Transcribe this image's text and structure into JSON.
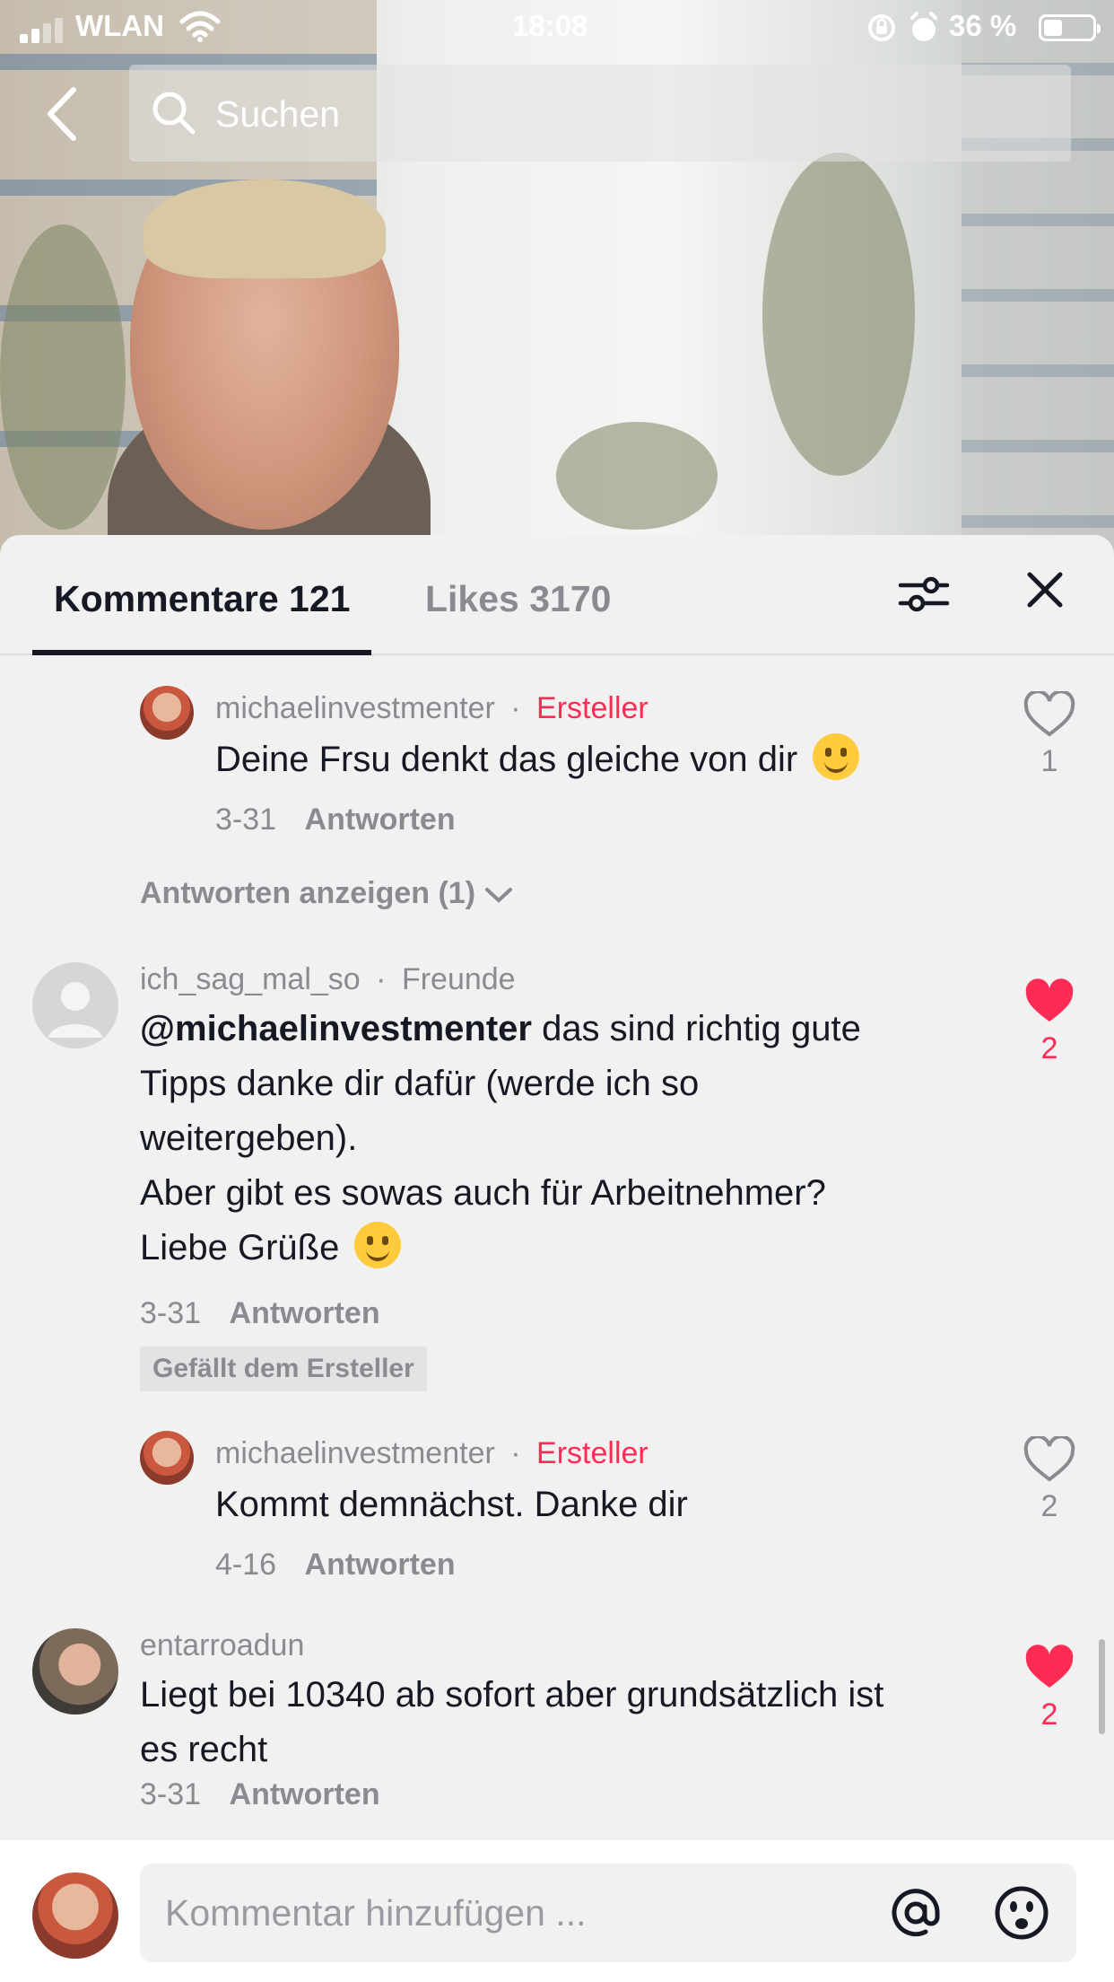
{
  "status": {
    "carrier": "WLAN",
    "time": "18:08",
    "battery": "36 %"
  },
  "search": {
    "placeholder": "Suchen"
  },
  "tabs": {
    "comments": "Kommentare 121",
    "likes": "Likes 3170"
  },
  "comments": [
    {
      "username": "michaelinvestmenter",
      "separator": "·",
      "tag": "Ersteller",
      "text": "Deine Frsu denkt das gleiche von dir",
      "emoji": "grinning-sweat-emoji",
      "date": "3-31",
      "reply": "Antworten",
      "likes": "1",
      "liked": false
    },
    {
      "show_replies": "Antworten anzeigen (1)"
    },
    {
      "username": "ich_sag_mal_so",
      "separator": "·",
      "tag": "Freunde",
      "mention": "@michaelinvestmenter",
      "text_lines": [
        " das sind richtig gute",
        "Tipps danke dir dafür (werde ich so",
        "weitergeben).",
        "Aber gibt es sowas auch für Arbeitnehmer?",
        "Liebe Grüße"
      ],
      "emoji": "winking-face-emoji",
      "date": "3-31",
      "reply": "Antworten",
      "badge": "Gefällt dem Ersteller",
      "likes": "2",
      "liked": true
    },
    {
      "username": "michaelinvestmenter",
      "separator": "·",
      "tag": "Ersteller",
      "text": "Kommt demnächst. Danke dir",
      "date": "4-16",
      "reply": "Antworten",
      "likes": "2",
      "liked": false
    },
    {
      "username": "entarroadun",
      "text_lines": [
        "Liegt bei 10340 ab sofort aber grundsätzlich ist",
        "es recht"
      ],
      "date": "3-31",
      "reply": "Antworten",
      "likes": "2",
      "liked": true
    }
  ],
  "composer": {
    "placeholder": "Kommentar hinzufügen ..."
  },
  "colors": {
    "accent": "#fe2c55",
    "text": "#161823",
    "muted": "#8a8b91",
    "panel": "#f1f1f2"
  }
}
